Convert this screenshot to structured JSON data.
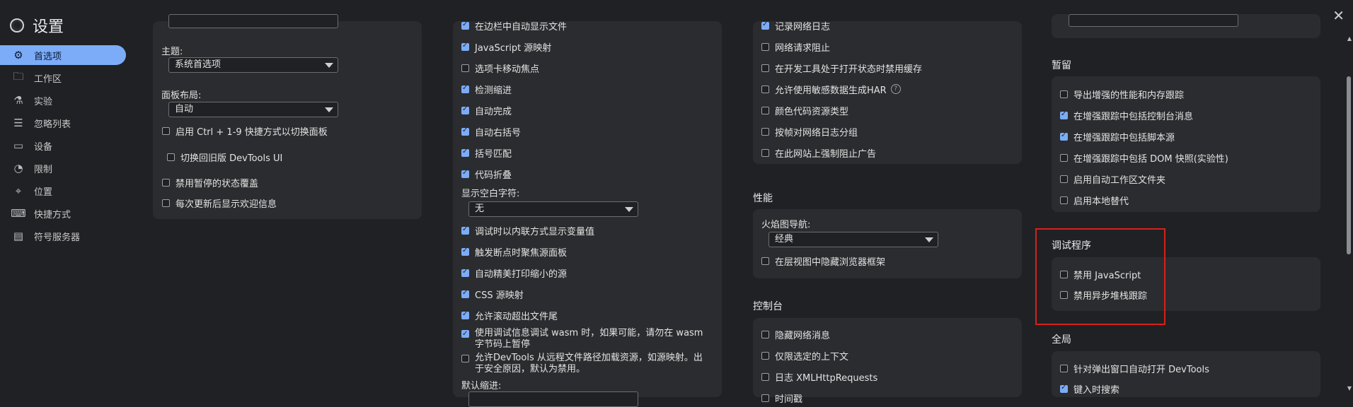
{
  "app": {
    "title": "设置"
  },
  "sidebar": {
    "items": [
      {
        "label": "首选项",
        "icon": "gear-icon",
        "glyph": "⚙",
        "active": true
      },
      {
        "label": "工作区",
        "icon": "folder-icon",
        "glyph": "🗀"
      },
      {
        "label": "实验",
        "icon": "flask-icon",
        "glyph": "⚗"
      },
      {
        "label": "忽略列表",
        "icon": "list-icon",
        "glyph": "☰"
      },
      {
        "label": "设备",
        "icon": "devices-icon",
        "glyph": "▭"
      },
      {
        "label": "限制",
        "icon": "speed-icon",
        "glyph": "◔"
      },
      {
        "label": "位置",
        "icon": "location-pin-icon",
        "glyph": "⌖"
      },
      {
        "label": "快捷方式",
        "icon": "keyboard-icon",
        "glyph": "⌨"
      },
      {
        "label": "符号服务器",
        "icon": "symbol-server-icon",
        "glyph": "▤"
      }
    ]
  },
  "col1": {
    "theme_label": "主题:",
    "theme_value": "系统首选项",
    "panel_layout_label": "面板布局:",
    "panel_layout_value": "自动",
    "checkboxes": [
      {
        "label": "启用 Ctrl + 1-9 快捷方式以切换面板",
        "checked": false
      },
      {
        "label": "切换回旧版 DevTools UI",
        "checked": false
      },
      {
        "label": "禁用暂停的状态覆盖",
        "checked": false
      },
      {
        "label": "每次更新后显示欢迎信息",
        "checked": false
      }
    ]
  },
  "col2": {
    "checkboxes_top": [
      {
        "label": "在边栏中自动显示文件",
        "checked": true
      },
      {
        "label": "JavaScript 源映射",
        "checked": true
      },
      {
        "label": "选项卡移动焦点",
        "checked": false
      },
      {
        "label": "检测缩进",
        "checked": true
      },
      {
        "label": "自动完成",
        "checked": true
      },
      {
        "label": "自动右括号",
        "checked": true
      },
      {
        "label": "括号匹配",
        "checked": true
      },
      {
        "label": "代码折叠",
        "checked": true
      }
    ],
    "whitespace_label": "显示空白字符:",
    "whitespace_value": "无",
    "checkboxes_bottom": [
      {
        "label": "调试时以内联方式显示变量值",
        "checked": true
      },
      {
        "label": "触发断点时聚焦源面板",
        "checked": true
      },
      {
        "label": "自动精美打印缩小的源",
        "checked": true
      },
      {
        "label": "CSS 源映射",
        "checked": true
      },
      {
        "label": "允许滚动超出文件尾",
        "checked": true
      },
      {
        "label": "使用调试信息调试 wasm 时，如果可能，请勿在 wasm 字节码上暂停",
        "checked": true
      },
      {
        "label": "允许DevTools 从远程文件路径加载资源，如源映射。出于安全原因，默认为禁用。",
        "checked": false
      }
    ],
    "default_indent_label": "默认缩进:"
  },
  "col3": {
    "network_checkboxes": [
      {
        "label": "记录网络日志",
        "checked": true
      },
      {
        "label": "网络请求阻止",
        "checked": false
      },
      {
        "label": "在开发工具处于打开状态时禁用缓存",
        "checked": false
      },
      {
        "label": "允许使用敏感数据生成HAR",
        "checked": false,
        "help": "?"
      },
      {
        "label": "颜色代码资源类型",
        "checked": false
      },
      {
        "label": "按帧对网络日志分组",
        "checked": false
      },
      {
        "label": "在此网站上强制阻止广告",
        "checked": false
      }
    ],
    "performance_title": "性能",
    "flame_nav_label": "火焰图导航:",
    "flame_nav_value": "经典",
    "performance_checkbox": {
      "label": "在层视图中隐藏浏览器框架",
      "checked": false
    },
    "console_title": "控制台",
    "console_checkboxes": [
      {
        "label": "隐藏网络消息",
        "checked": false
      },
      {
        "label": "仅限选定的上下文",
        "checked": false
      },
      {
        "label": "日志 XMLHttpRequests",
        "checked": false
      },
      {
        "label": "时间戳",
        "checked": false
      }
    ]
  },
  "col4": {
    "persist_title": "暂留",
    "persist_checkboxes": [
      {
        "label": "导出增强的性能和内存跟踪",
        "checked": false
      },
      {
        "label": "在增强跟踪中包括控制台消息",
        "checked": true
      },
      {
        "label": "在增强跟踪中包括脚本源",
        "checked": true
      },
      {
        "label": "在增强跟踪中包括 DOM 快照(实验性)",
        "checked": false
      },
      {
        "label": "启用自动工作区文件夹",
        "checked": false
      },
      {
        "label": "启用本地替代",
        "checked": false
      }
    ],
    "debugger_title": "调试程序",
    "debugger_checkboxes": [
      {
        "label": "禁用 JavaScript",
        "checked": false
      },
      {
        "label": "禁用异步堆栈跟踪",
        "checked": false
      }
    ],
    "global_title": "全局",
    "global_checkboxes": [
      {
        "label": "针对弹出窗口自动打开 DevTools",
        "checked": false
      },
      {
        "label": "键入时搜索",
        "checked": true
      }
    ]
  },
  "colors": {
    "accent": "#7cacf8",
    "highlight": "#d6211b"
  }
}
